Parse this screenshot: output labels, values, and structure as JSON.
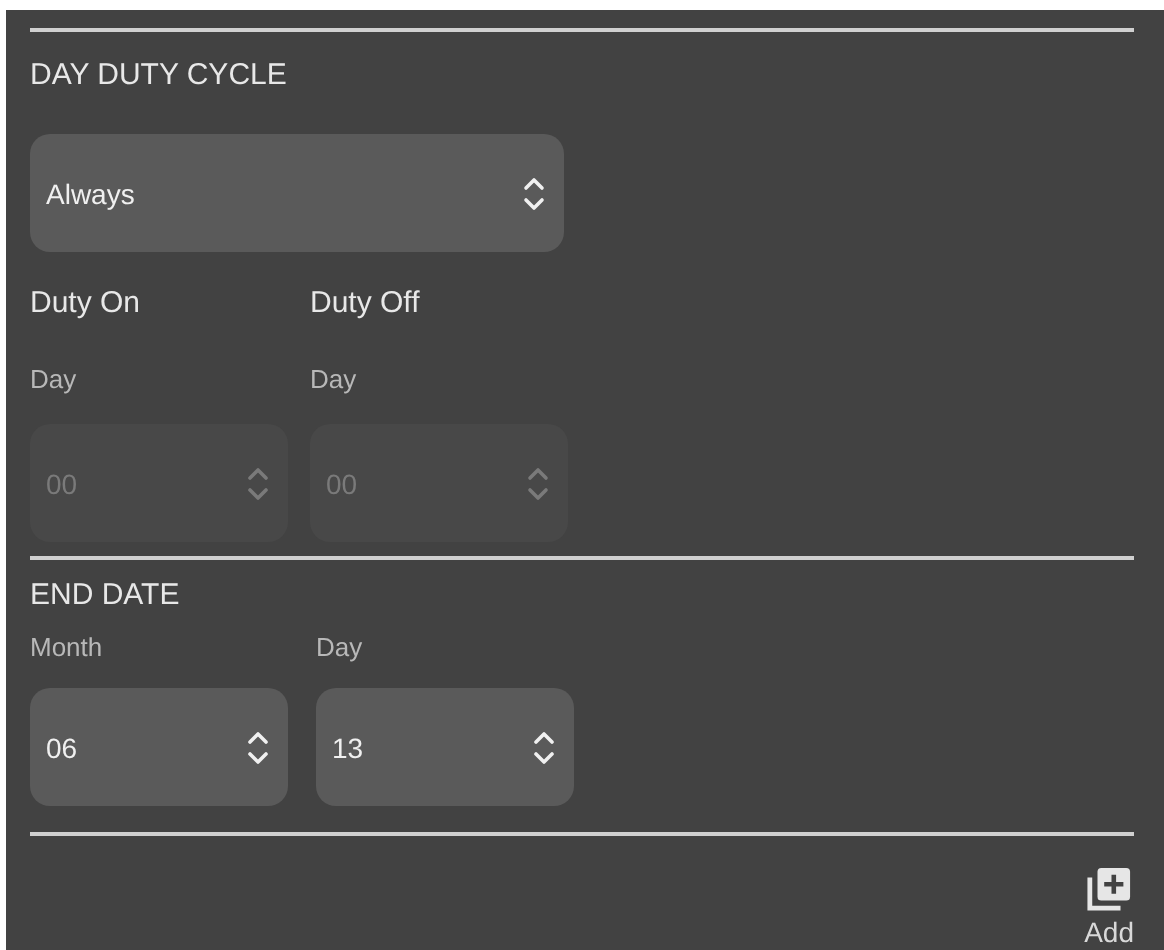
{
  "day_duty_cycle": {
    "title": "DAY DUTY CYCLE",
    "select": {
      "value": "Always"
    },
    "columns": [
      {
        "label": "Duty On",
        "sublabel": "Day",
        "value": "00",
        "disabled": true
      },
      {
        "label": "Duty Off",
        "sublabel": "Day",
        "value": "00",
        "disabled": true
      }
    ]
  },
  "end_date": {
    "title": "END DATE",
    "fields": [
      {
        "label": "Month",
        "value": "06",
        "disabled": false
      },
      {
        "label": "Day",
        "value": "13",
        "disabled": false
      }
    ]
  },
  "add_button": {
    "label": "Add"
  }
}
